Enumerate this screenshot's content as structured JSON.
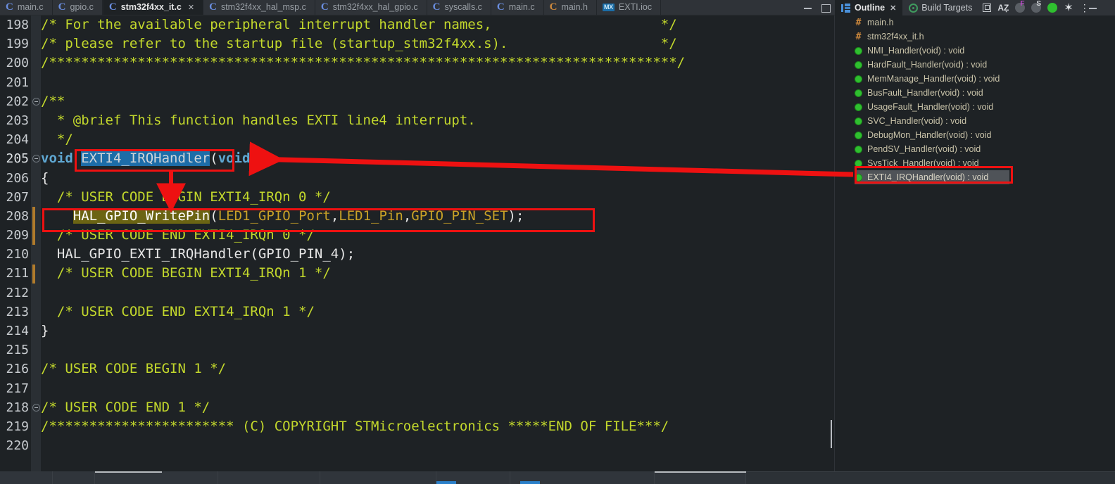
{
  "window": {
    "editor_tabs": [
      {
        "label": "main.c",
        "icon": "c-file-icon",
        "icon_kind": "c",
        "active": false,
        "closable": false
      },
      {
        "label": "gpio.c",
        "icon": "c-file-icon",
        "icon_kind": "c",
        "active": false,
        "closable": false
      },
      {
        "label": "stm32f4xx_it.c",
        "icon": "c-file-icon",
        "icon_kind": "c",
        "active": true,
        "closable": true
      },
      {
        "label": "stm32f4xx_hal_msp.c",
        "icon": "c-file-icon",
        "icon_kind": "c",
        "active": false,
        "closable": false
      },
      {
        "label": "stm32f4xx_hal_gpio.c",
        "icon": "c-file-icon",
        "icon_kind": "c",
        "active": false,
        "closable": false
      },
      {
        "label": "syscalls.c",
        "icon": "c-file-icon",
        "icon_kind": "c",
        "active": false,
        "closable": false
      },
      {
        "label": "main.c",
        "icon": "c-file-icon",
        "icon_kind": "c",
        "active": false,
        "closable": false
      },
      {
        "label": "main.h",
        "icon": "h-file-icon",
        "icon_kind": "h",
        "active": false,
        "closable": false
      },
      {
        "label": "EXTI.ioc",
        "icon": "ioc-file-icon",
        "icon_kind": "ioc",
        "active": false,
        "closable": false
      }
    ],
    "close_glyph": "✕",
    "minimize_title": "Minimize",
    "maximize_title": "Maximize"
  },
  "right_panel": {
    "tabs": [
      {
        "label": "Outline",
        "icon": "outline-icon",
        "active": true,
        "closable": true
      },
      {
        "label": "Build Targets",
        "icon": "build-targets-icon",
        "active": false,
        "closable": false
      }
    ],
    "close_glyph": "✕",
    "toolbar": [
      {
        "name": "collapse-all-icon",
        "glyph": "⧉"
      },
      {
        "name": "sort-alphabetically-icon",
        "glyph": "AẐ"
      },
      {
        "name": "hide-fields-icon",
        "glyph": "F"
      },
      {
        "name": "hide-static-icon",
        "glyph": "S"
      },
      {
        "name": "hide-non-public-icon",
        "glyph": "●"
      },
      {
        "name": "filters-icon",
        "glyph": "✶"
      },
      {
        "name": "view-menu-icon",
        "glyph": "⋮"
      }
    ],
    "outline_items": [
      {
        "label": "main.h",
        "kind": "include"
      },
      {
        "label": "stm32f4xx_it.h",
        "kind": "include"
      },
      {
        "label": "NMI_Handler(void) : void",
        "kind": "function"
      },
      {
        "label": "HardFault_Handler(void) : void",
        "kind": "function"
      },
      {
        "label": "MemManage_Handler(void) : void",
        "kind": "function"
      },
      {
        "label": "BusFault_Handler(void) : void",
        "kind": "function"
      },
      {
        "label": "UsageFault_Handler(void) : void",
        "kind": "function"
      },
      {
        "label": "SVC_Handler(void) : void",
        "kind": "function"
      },
      {
        "label": "DebugMon_Handler(void) : void",
        "kind": "function"
      },
      {
        "label": "PendSV_Handler(void) : void",
        "kind": "function"
      },
      {
        "label": "SysTick_Handler(void) : void",
        "kind": "function"
      },
      {
        "label": "EXTI4_IRQHandler(void) : void",
        "kind": "function",
        "selected": true,
        "annotated": true
      }
    ],
    "include_glyph": "#"
  },
  "editor": {
    "first_line": 198,
    "current_line": 205,
    "selection_text": "EXTI4_IRQHandler",
    "occurrence_text": "HAL_GPIO_WritePin",
    "lines": [
      {
        "n": 198,
        "text": "/* For the available peripheral interrupt handler names,                     */"
      },
      {
        "n": 199,
        "text": "/* please refer to the startup file (startup_stm32f4xx.s).                   */"
      },
      {
        "n": 200,
        "text": "/******************************************************************************/"
      },
      {
        "n": 201,
        "text": ""
      },
      {
        "n": 202,
        "text": "/**",
        "fold": true
      },
      {
        "n": 203,
        "text": "  * @brief This function handles EXTI line4 interrupt."
      },
      {
        "n": 204,
        "text": "  */"
      },
      {
        "n": 205,
        "text": "void EXTI4_IRQHandler(void)",
        "fold": true,
        "current": true
      },
      {
        "n": 206,
        "text": "{"
      },
      {
        "n": 207,
        "text": "  /* USER CODE BEGIN EXTI4_IRQn 0 */"
      },
      {
        "n": 208,
        "text": "    HAL_GPIO_WritePin(LED1_GPIO_Port,LED1_Pin,GPIO_PIN_SET);",
        "changed": true
      },
      {
        "n": 209,
        "text": "  /* USER CODE END EXTI4_IRQn 0 */",
        "changed": true
      },
      {
        "n": 210,
        "text": "  HAL_GPIO_EXTI_IRQHandler(GPIO_PIN_4);"
      },
      {
        "n": 211,
        "text": "  /* USER CODE BEGIN EXTI4_IRQn 1 */",
        "changed": true
      },
      {
        "n": 212,
        "text": ""
      },
      {
        "n": 213,
        "text": "  /* USER CODE END EXTI4_IRQn 1 */"
      },
      {
        "n": 214,
        "text": "}"
      },
      {
        "n": 215,
        "text": ""
      },
      {
        "n": 216,
        "text": "/* USER CODE BEGIN 1 */"
      },
      {
        "n": 217,
        "text": ""
      },
      {
        "n": 218,
        "text": "/* USER CODE END 1 */",
        "fold": true
      },
      {
        "n": 219,
        "text": "/*********************** (C) COPYRIGHT STMicroelectronics *****END OF FILE***/"
      },
      {
        "n": 220,
        "text": ""
      }
    ]
  },
  "annotations": {
    "rect_selection_label": "EXTI4_IRQHandler selection highlight box",
    "rect_statement_label": "HAL_GPIO_WritePin statement box",
    "rect_outline_label": "EXTI4_IRQHandler outline entry box",
    "arrow_long_label": "arrow from outline entry to function definition",
    "arrow_down_label": "arrow from function definition to statement",
    "color": "#ee1111"
  },
  "colors": {
    "background": "#1e2225",
    "chrome": "#2f3338",
    "comment": "#c3d82c",
    "keyword": "#5fa8d3",
    "macro": "#c9a227",
    "text": "#e6e6e6",
    "selection": "#1d6da8",
    "occurrence": "#6b6413",
    "outline_text": "#c8c2a8",
    "annotation": "#ee1111"
  }
}
